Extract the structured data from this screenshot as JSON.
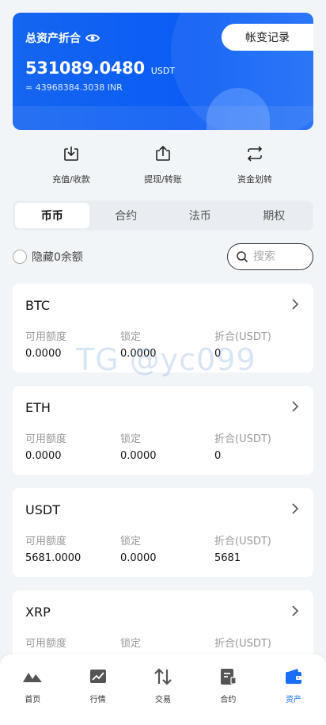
{
  "asset": {
    "total_label": "总资产折合",
    "record_button": "帐变记录",
    "total_value": "531089.0480",
    "total_unit": "USDT",
    "inr_value": "≈ 43968384.3038 INR"
  },
  "actions": [
    {
      "label": "充值/收款",
      "icon": "download-icon"
    },
    {
      "label": "提现/转账",
      "icon": "upload-icon"
    },
    {
      "label": "资金划转",
      "icon": "transfer-icon"
    }
  ],
  "tabs": [
    {
      "label": "币币",
      "active": true
    },
    {
      "label": "合约",
      "active": false
    },
    {
      "label": "法币",
      "active": false
    },
    {
      "label": "期权",
      "active": false
    }
  ],
  "filter": {
    "hide_zero_label": "隐藏0余额",
    "search_placeholder": "搜索"
  },
  "columns": {
    "available": "可用额度",
    "locked": "锁定",
    "converted": "折合(USDT)"
  },
  "coins": [
    {
      "name": "BTC",
      "available": "0.0000",
      "locked": "0.0000",
      "converted": "0"
    },
    {
      "name": "ETH",
      "available": "0.0000",
      "locked": "0.0000",
      "converted": "0"
    },
    {
      "name": "USDT",
      "available": "5681.0000",
      "locked": "0.0000",
      "converted": "5681"
    },
    {
      "name": "XRP",
      "available": "",
      "locked": "",
      "converted": ""
    }
  ],
  "watermark": "TG @yc099",
  "nav": [
    {
      "label": "首页",
      "icon": "home-icon",
      "active": false
    },
    {
      "label": "行情",
      "icon": "market-icon",
      "active": false
    },
    {
      "label": "交易",
      "icon": "trade-icon",
      "active": false
    },
    {
      "label": "合约",
      "icon": "contract-icon",
      "active": false
    },
    {
      "label": "资产",
      "icon": "wallet-icon",
      "active": true
    }
  ],
  "colors": {
    "primary": "#1a6ef5",
    "card_blue": "#0a5cf5",
    "background": "#f2f5f8"
  }
}
